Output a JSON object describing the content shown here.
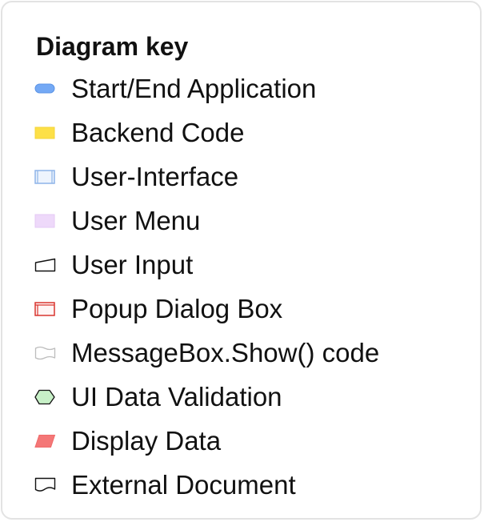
{
  "legend": {
    "title": "Diagram key",
    "items": [
      {
        "label": "Start/End Application",
        "icon": "start-end-pill-icon",
        "color": "#74a9f5"
      },
      {
        "label": "Backend Code",
        "icon": "backend-rectangle-icon",
        "color": "#fde047"
      },
      {
        "label": "User-Interface",
        "icon": "ui-framed-rectangle-icon",
        "color": "#a9c8f0"
      },
      {
        "label": "User Menu",
        "icon": "user-menu-rectangle-icon",
        "color": "#eed9fa"
      },
      {
        "label": "User Input",
        "icon": "manual-input-icon",
        "color": "#111111"
      },
      {
        "label": "Popup Dialog Box",
        "icon": "popup-framed-rectangle-icon",
        "color": "#d9352e"
      },
      {
        "label": "MessageBox.Show() code",
        "icon": "messagebox-wave-icon",
        "color": "#bdbdbd"
      },
      {
        "label": "UI Data Validation",
        "icon": "hexagon-icon",
        "color": "#c7f0c7"
      },
      {
        "label": "Display Data",
        "icon": "parallelogram-icon",
        "color": "#f47777"
      },
      {
        "label": "External Document",
        "icon": "document-icon",
        "color": "#111111"
      }
    ]
  }
}
